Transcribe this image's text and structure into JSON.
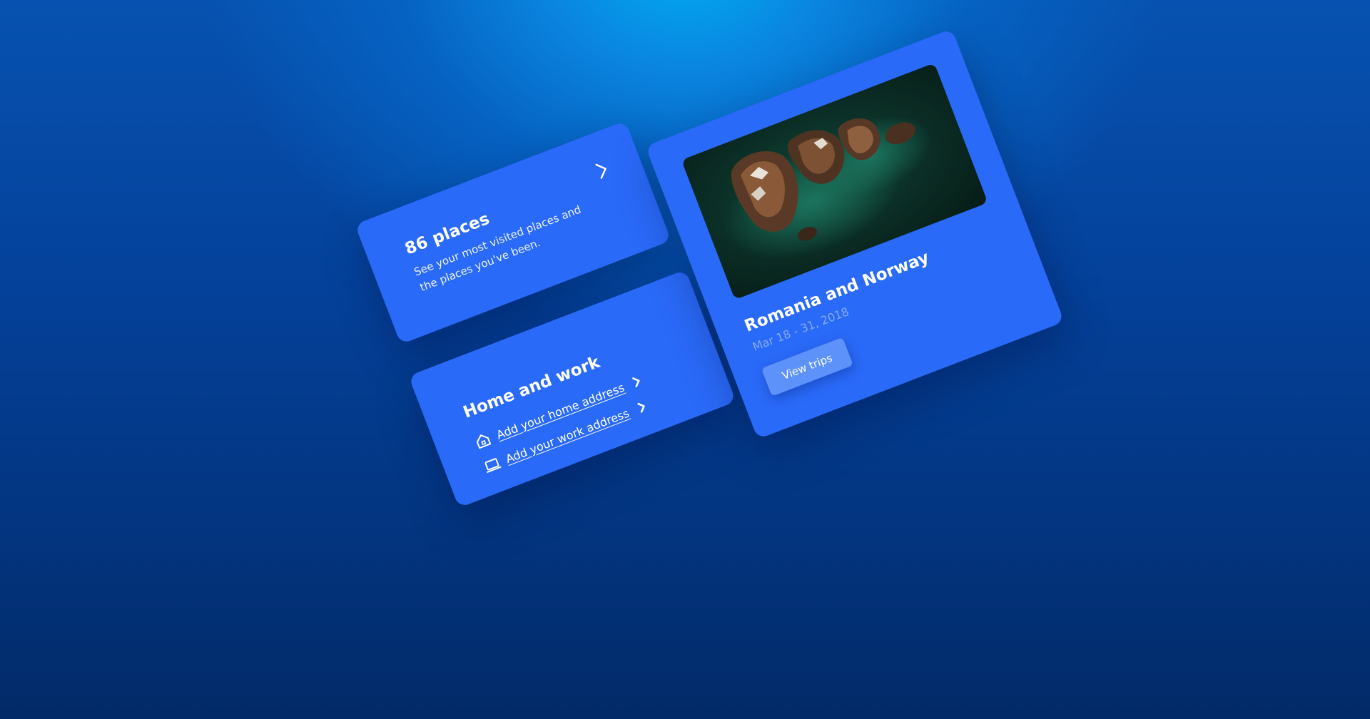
{
  "places_card": {
    "title": "86 places",
    "description": "See your most visited places and the places you've been.",
    "chevron_icon": "chevron-right-icon"
  },
  "home_work_card": {
    "title": "Home and work",
    "home_link": "Add your home address",
    "home_icon": "home-icon",
    "work_link": "Add your work address",
    "work_icon": "laptop-icon"
  },
  "trip_card": {
    "title": "Romania and Norway",
    "dates": "Mar 18 - 31, 2018",
    "button_label": "View trips",
    "photo": "aerial-coast-photo"
  },
  "colors": {
    "card": "#2a6af8",
    "button": "#5d92fb",
    "dates_text": "#86a9f7",
    "background_top": "#00adf4",
    "background_bottom": "#022a68"
  }
}
